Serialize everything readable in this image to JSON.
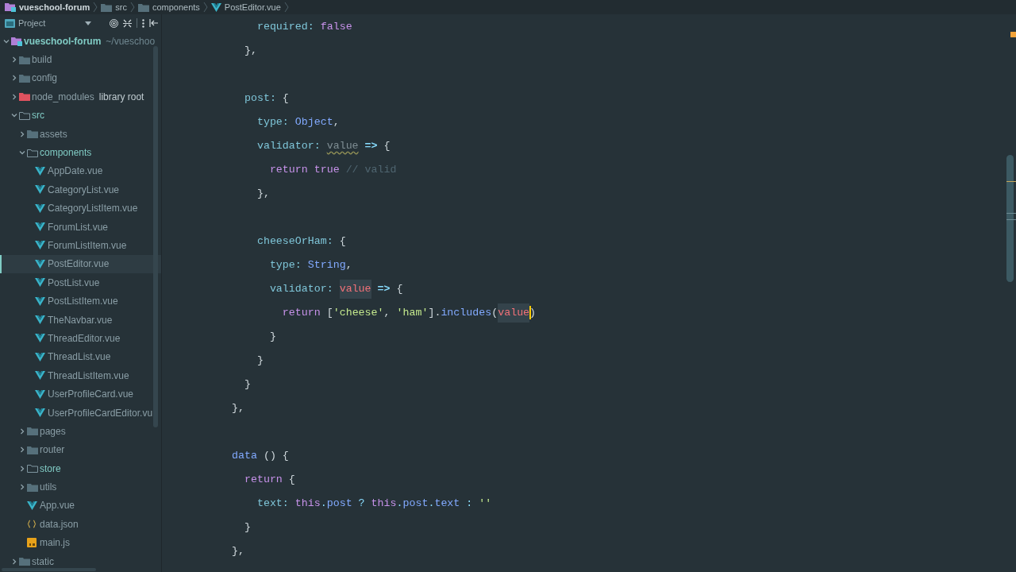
{
  "breadcrumbs": [
    {
      "kind": "module",
      "text": "vueschool-forum"
    },
    {
      "kind": "folder",
      "text": "src"
    },
    {
      "kind": "folder",
      "text": "components"
    },
    {
      "kind": "vue",
      "text": "PostEditor.vue"
    }
  ],
  "project_panel": {
    "title": "Project"
  },
  "tree": [
    {
      "kind": "module",
      "label": "vueschool-forum",
      "hint": "~/vueschoo",
      "expanded": true,
      "selected": false,
      "children": [
        {
          "kind": "folder",
          "label": "build",
          "expanded": false,
          "selected": false
        },
        {
          "kind": "folder",
          "label": "config",
          "expanded": false,
          "selected": false
        },
        {
          "kind": "library-folder",
          "label": "node_modules",
          "hint": "library root",
          "expanded": false,
          "selected": false
        },
        {
          "kind": "source-folder",
          "label": "src",
          "expanded": true,
          "selected": false,
          "children": [
            {
              "kind": "folder",
              "label": "assets",
              "expanded": false,
              "selected": false
            },
            {
              "kind": "source-folder",
              "label": "components",
              "expanded": true,
              "selected": false,
              "children": [
                {
                  "kind": "vue",
                  "label": "AppDate.vue",
                  "selected": false
                },
                {
                  "kind": "vue",
                  "label": "CategoryList.vue",
                  "selected": false
                },
                {
                  "kind": "vue",
                  "label": "CategoryListItem.vue",
                  "selected": false
                },
                {
                  "kind": "vue",
                  "label": "ForumList.vue",
                  "selected": false
                },
                {
                  "kind": "vue",
                  "label": "ForumListItem.vue",
                  "selected": false
                },
                {
                  "kind": "vue",
                  "label": "PostEditor.vue",
                  "selected": true
                },
                {
                  "kind": "vue",
                  "label": "PostList.vue",
                  "selected": false
                },
                {
                  "kind": "vue",
                  "label": "PostListItem.vue",
                  "selected": false
                },
                {
                  "kind": "vue",
                  "label": "TheNavbar.vue",
                  "selected": false
                },
                {
                  "kind": "vue",
                  "label": "ThreadEditor.vue",
                  "selected": false
                },
                {
                  "kind": "vue",
                  "label": "ThreadList.vue",
                  "selected": false
                },
                {
                  "kind": "vue",
                  "label": "ThreadListItem.vue",
                  "selected": false
                },
                {
                  "kind": "vue",
                  "label": "UserProfileCard.vue",
                  "selected": false
                },
                {
                  "kind": "vue",
                  "label": "UserProfileCardEditor.vu",
                  "selected": false
                }
              ]
            },
            {
              "kind": "folder",
              "label": "pages",
              "expanded": false,
              "selected": false
            },
            {
              "kind": "folder",
              "label": "router",
              "expanded": false,
              "selected": false
            },
            {
              "kind": "source-folder",
              "label": "store",
              "expanded": false,
              "selected": false
            },
            {
              "kind": "folder",
              "label": "utils",
              "expanded": false,
              "selected": false
            },
            {
              "kind": "vue",
              "label": "App.vue",
              "selected": false
            },
            {
              "kind": "json",
              "label": "data.json",
              "selected": false
            },
            {
              "kind": "js",
              "label": "main.js",
              "selected": false
            }
          ]
        },
        {
          "kind": "folder",
          "label": "static",
          "expanded": false,
          "selected": false
        }
      ]
    }
  ],
  "code_lines": [
    {
      "tokens": [
        {
          "kind": "key",
          "text": "    required:"
        },
        {
          "kind": "keyword",
          "text": " false"
        }
      ]
    },
    {
      "tokens": [
        {
          "kind": "punct",
          "text": "  },"
        }
      ]
    },
    {
      "gap_before": true,
      "tokens": [
        {
          "kind": "key",
          "text": "  post:"
        },
        {
          "kind": "punct",
          "text": " {"
        }
      ]
    },
    {
      "tokens": [
        {
          "kind": "key",
          "text": "    type:"
        },
        {
          "kind": "class",
          "text": " Object"
        },
        {
          "kind": "punct",
          "text": ","
        }
      ]
    },
    {
      "tokens": [
        {
          "kind": "key",
          "text": "    validator: "
        },
        {
          "kind": "unused-param",
          "text": "value"
        },
        {
          "kind": "arrow",
          "text": " =>"
        },
        {
          "kind": "punct",
          "text": " {"
        }
      ]
    },
    {
      "tokens": [
        {
          "kind": "keyword",
          "text": "      return true"
        },
        {
          "kind": "comment",
          "text": " // valid"
        }
      ]
    },
    {
      "tokens": [
        {
          "kind": "punct",
          "text": "    },"
        }
      ]
    },
    {
      "gap_before": true,
      "tokens": [
        {
          "kind": "key",
          "text": "    cheeseOrHam:"
        },
        {
          "kind": "punct",
          "text": " {"
        }
      ]
    },
    {
      "tokens": [
        {
          "kind": "key",
          "text": "      type:"
        },
        {
          "kind": "class",
          "text": " String"
        },
        {
          "kind": "punct",
          "text": ","
        }
      ]
    },
    {
      "tokens": [
        {
          "kind": "key",
          "text": "      validator: "
        },
        {
          "kind": "param",
          "text": "value",
          "highlighted": true
        },
        {
          "kind": "arrow",
          "text": " =>"
        },
        {
          "kind": "punct",
          "text": " {"
        }
      ]
    },
    {
      "tokens": [
        {
          "kind": "keyword",
          "text": "        return"
        },
        {
          "kind": "punct",
          "text": " ["
        },
        {
          "kind": "string",
          "text": "'cheese'"
        },
        {
          "kind": "punct",
          "text": ", "
        },
        {
          "kind": "string",
          "text": "'ham'"
        },
        {
          "kind": "punct",
          "text": "]."
        },
        {
          "kind": "method",
          "text": "includes"
        },
        {
          "kind": "punct",
          "text": "("
        },
        {
          "kind": "param",
          "text": "value",
          "highlighted": true,
          "caret_after": true
        },
        {
          "kind": "punct",
          "text": ")"
        }
      ]
    },
    {
      "tokens": [
        {
          "kind": "punct",
          "text": "      }"
        }
      ]
    },
    {
      "tokens": [
        {
          "kind": "punct",
          "text": "    }"
        }
      ]
    },
    {
      "tokens": [
        {
          "kind": "punct",
          "text": "  }"
        }
      ]
    },
    {
      "tokens": [
        {
          "kind": "punct",
          "text": "},"
        }
      ]
    },
    {
      "gap_before": true,
      "tokens": [
        {
          "kind": "method",
          "text": "data"
        },
        {
          "kind": "punct",
          "text": " () {"
        }
      ]
    },
    {
      "tokens": [
        {
          "kind": "keyword",
          "text": "  return"
        },
        {
          "kind": "punct",
          "text": " {"
        }
      ]
    },
    {
      "tokens": [
        {
          "kind": "key",
          "text": "    text:"
        },
        {
          "kind": "keyword",
          "text": " this"
        },
        {
          "kind": "op",
          "text": "."
        },
        {
          "kind": "prop",
          "text": "post"
        },
        {
          "kind": "op",
          "text": " ?"
        },
        {
          "kind": "keyword",
          "text": " this"
        },
        {
          "kind": "op",
          "text": "."
        },
        {
          "kind": "prop",
          "text": "post"
        },
        {
          "kind": "op",
          "text": "."
        },
        {
          "kind": "prop",
          "text": "text"
        },
        {
          "kind": "op",
          "text": " :"
        },
        {
          "kind": "string",
          "text": " ''"
        }
      ]
    },
    {
      "tokens": [
        {
          "kind": "punct",
          "text": "  }"
        }
      ]
    },
    {
      "tokens": [
        {
          "kind": "punct",
          "text": "},"
        }
      ]
    }
  ]
}
